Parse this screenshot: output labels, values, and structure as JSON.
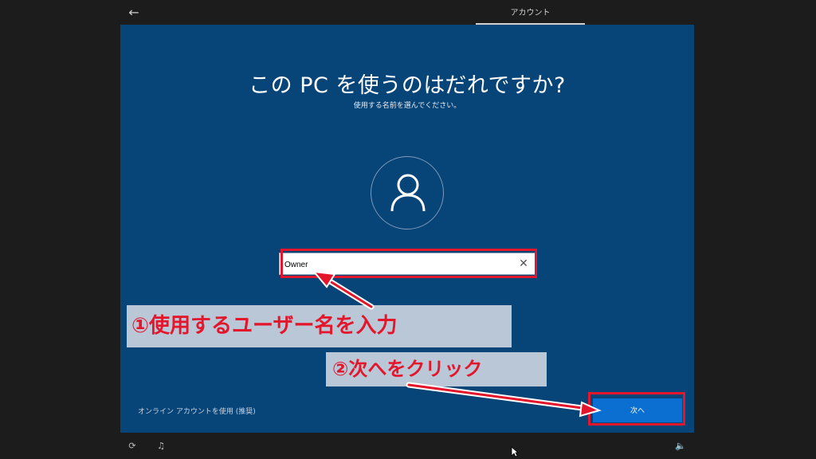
{
  "topbar": {
    "back_icon": "arrow-left-icon",
    "tab_label": "アカウント"
  },
  "main": {
    "heading": "この PC を使うのはだれですか?",
    "subheading": "使用する名前を選んでください。",
    "avatar_icon": "person-icon",
    "name_input": {
      "value": "Owner",
      "clear_icon": "close-icon"
    },
    "online_account_link": "オンライン アカウントを使用 (推奨)",
    "next_button_label": "次へ"
  },
  "annotations": {
    "step1": "①使用するユーザー名を入力",
    "step2": "②次へをクリック"
  },
  "bottombar": {
    "icons": [
      "accessibility-icon",
      "microphone-icon",
      "volume-icon"
    ]
  },
  "colors": {
    "panel": "#074478",
    "accent": "#0a6fd1",
    "highlight": "#e4162b",
    "callout_bg": "#b9c7d6"
  }
}
